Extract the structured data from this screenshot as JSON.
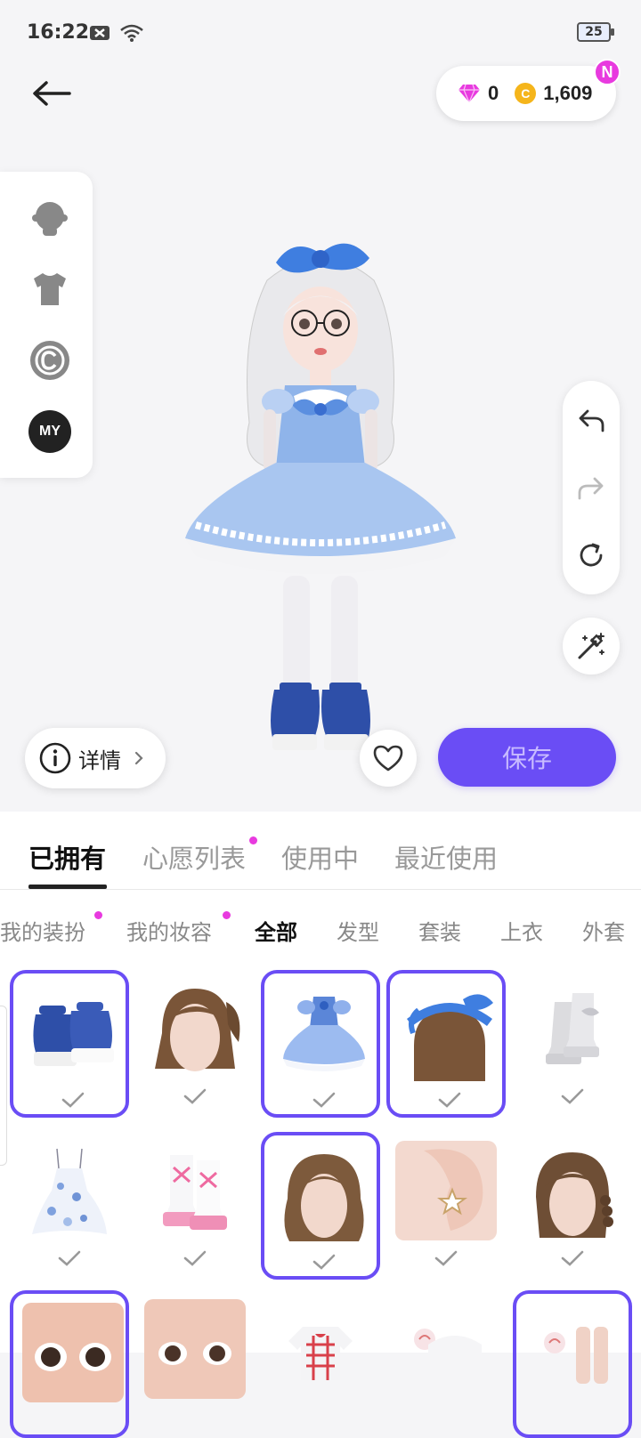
{
  "status_bar": {
    "time": "16:22",
    "battery": "25"
  },
  "currency": {
    "gems": "0",
    "coins": "1,609",
    "coin_symbol": "C",
    "new_badge": "N"
  },
  "left_panel": {
    "my_label": "MY"
  },
  "actions": {
    "details_label": "详情",
    "save_label": "保存"
  },
  "main_tabs": [
    "已拥有",
    "心愿列表",
    "使用中",
    "最近使用"
  ],
  "sub_tabs": [
    "我的装扮",
    "我的妆容",
    "全部",
    "发型",
    "套装",
    "上衣",
    "外套"
  ],
  "grid_items": [
    {
      "icon": "platform-shoes-blue-icon",
      "selected": true
    },
    {
      "icon": "hair-brown-side-tail-icon",
      "selected": false
    },
    {
      "icon": "lolita-dress-blue-icon",
      "selected": true
    },
    {
      "icon": "blue-bow-headband-icon",
      "selected": true
    },
    {
      "icon": "white-boots-icon",
      "selected": false
    },
    {
      "icon": "floral-slip-dress-icon",
      "selected": false
    },
    {
      "icon": "pink-lace-boots-icon",
      "selected": false
    },
    {
      "icon": "hair-brown-wavy-icon",
      "selected": true
    },
    {
      "icon": "star-earring-icon",
      "selected": false
    },
    {
      "icon": "hair-brown-braid-icon",
      "selected": false
    }
  ],
  "colors": {
    "accent": "#6a4df5",
    "badge": "#e83adf",
    "gem": "#e83adf",
    "coin": "#f5b51b"
  }
}
